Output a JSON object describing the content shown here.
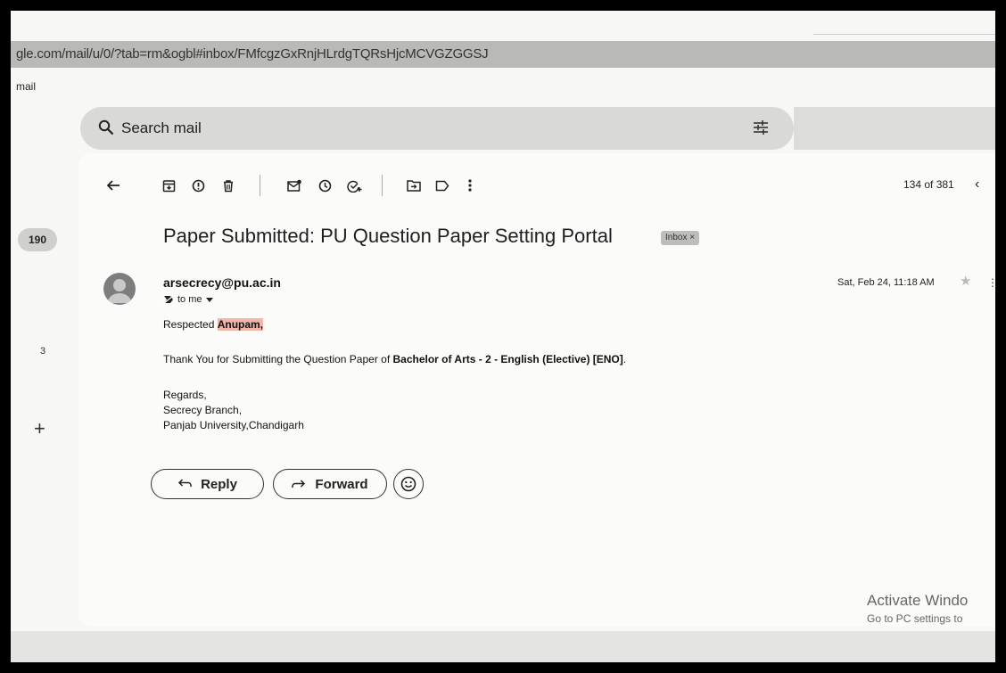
{
  "browser": {
    "url": "gle.com/mail/u/0/?tab=rm&ogbl#inbox/FMfcgzGxRnjHLrdgTQRsHjcMCVGZGGSJ",
    "app_label": "mail"
  },
  "search": {
    "placeholder": "Search mail"
  },
  "left_rail": {
    "inbox_count": "190",
    "other_count": "3",
    "add": "+"
  },
  "toolbar": {
    "icons": [
      "back-icon",
      "archive-icon",
      "report-spam-icon",
      "delete-icon",
      "mark-unread-icon",
      "snooze-icon",
      "add-task-icon",
      "move-to-icon",
      "label-icon",
      "more-vert-icon"
    ],
    "pager": "134 of 381",
    "prev": "‹"
  },
  "email": {
    "subject": "Paper Submitted: PU Question Paper Setting Portal",
    "label_chip": "Inbox ×",
    "sender": "arsecrecy@pu.ac.in",
    "to": "to me",
    "date": "Sat, Feb 24, 11:18 AM",
    "greeting_prefix": "Respected ",
    "greeting_name": "Anupam,",
    "line1_prefix": "Thank You for Submitting the Question Paper of ",
    "line1_bold": "Bachelor of Arts - 2 - English (Elective) [ENO]",
    "line1_suffix": ".",
    "sign1": "Regards,",
    "sign2": "Secrecy Branch,",
    "sign3": "Panjab University,Chandigarh"
  },
  "actions": {
    "reply": "Reply",
    "forward": "Forward"
  },
  "watermark": {
    "line1": "Activate Windo",
    "line2": "Go to PC settings to"
  }
}
